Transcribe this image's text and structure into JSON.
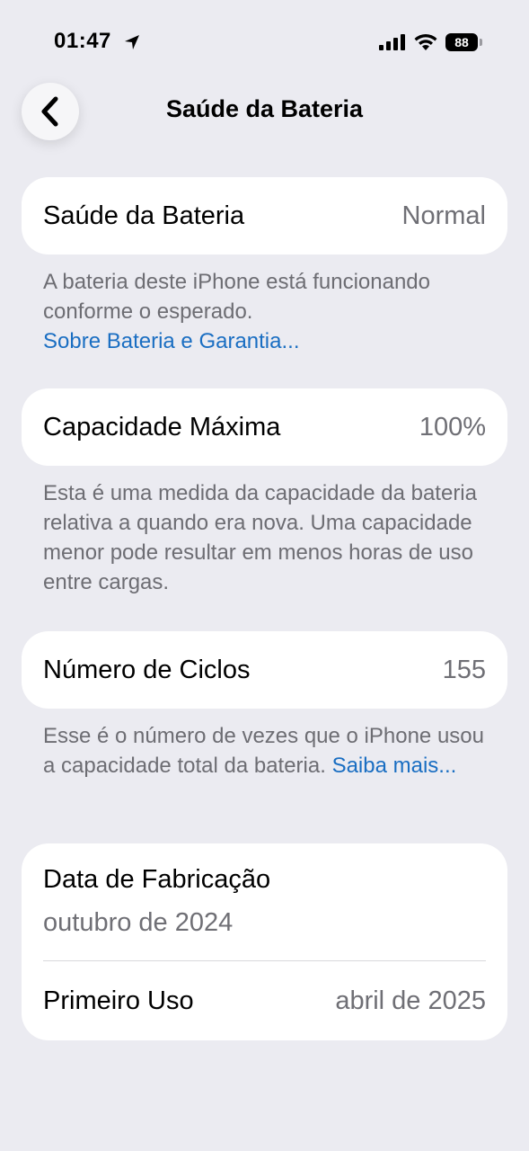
{
  "status_bar": {
    "time": "01:47",
    "battery": "88",
    "icons": [
      "location-arrow-icon",
      "cellular-signal-icon",
      "wifi-icon",
      "battery-icon"
    ]
  },
  "nav": {
    "title": "Saúde da Bateria",
    "back_icon": "chevron-left-icon"
  },
  "sections": {
    "health": {
      "label": "Saúde da Bateria",
      "value": "Normal",
      "note": "A bateria deste iPhone está funcionando conforme o esperado.",
      "link": "Sobre Bateria e Garantia..."
    },
    "capacity": {
      "label": "Capacidade Máxima",
      "value": "100%",
      "note": "Esta é uma medida da capacidade da bateria relativa a quando era nova. Uma capacidade menor pode resultar em menos horas de uso entre cargas."
    },
    "cycles": {
      "label": "Número de Ciclos",
      "value": "155",
      "note": "Esse é o número de vezes que o iPhone usou a capacidade total da bateria.",
      "link": "Saiba mais..."
    },
    "dates": {
      "manufacture_label": "Data de Fabricação",
      "manufacture_value": "outubro de 2024",
      "first_use_label": "Primeiro Uso",
      "first_use_value": "abril de 2025"
    }
  },
  "colors": {
    "background": "#ebebf1",
    "card": "#ffffff",
    "link": "#1a6ec2",
    "secondary_text": "#6d6d73"
  }
}
